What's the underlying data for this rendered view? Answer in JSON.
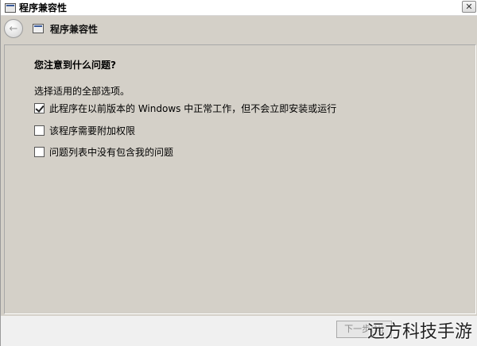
{
  "window": {
    "title": "程序兼容性",
    "close_label": "✕"
  },
  "nav": {
    "back_label": "←",
    "title": "程序兼容性"
  },
  "content": {
    "heading": "您注意到什么问题?",
    "instruction": "选择适用的全部选项。",
    "options": [
      {
        "label": "此程序在以前版本的 Windows 中正常工作，但不会立即安装或运行",
        "checked": true
      },
      {
        "label": "该程序需要附加权限",
        "checked": false
      },
      {
        "label": "问题列表中没有包含我的问题",
        "checked": false
      }
    ]
  },
  "footer": {
    "next_label": "下一步(N)"
  },
  "watermark": "远方科技手游"
}
